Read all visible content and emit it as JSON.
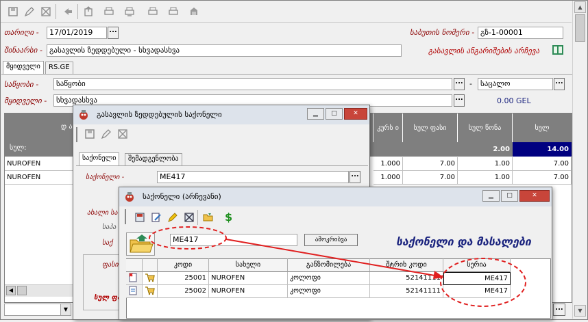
{
  "colors": {
    "label": "#8b0000",
    "accent_blue": "#1a237e",
    "total_row": "#000080",
    "grid_header": "#7f7f7f",
    "annotation": "#e02020"
  },
  "main": {
    "toolbar_icons": [
      "save-icon",
      "edit-icon",
      "delete-icon",
      "back-arrow-icon",
      "export-icon",
      "print-icon",
      "print-preview-icon",
      "copy-icon",
      "paste-icon",
      "archive-icon"
    ],
    "date_label": "თარიღი -",
    "date_value": "17/01/2019",
    "doc_number_label": "საბუთის ნომერი -",
    "doc_number_value": "გზ-1-00001",
    "note_label": "შინაარსი -",
    "note_value": "გასავლის ზედდებული - სხვადასხვა",
    "invoice_link": "გასავლის ანგარიშების არჩევა",
    "tabs": [
      "მყიდველი",
      "RS.GE"
    ],
    "warehouse_label": "საწყობი -",
    "warehouse_value": "საწყობი",
    "price_type_value": "საცალო",
    "buyer_label": "მყიდველი -",
    "buyer_value": "სხვადასხვა",
    "buyer_balance": "0.00 GEL",
    "grid": {
      "headers": {
        "name_partial": "დ ა",
        "rate": "კურს ი",
        "total_price": "სულ ფასი",
        "total_weight": "სულ წონა",
        "total": "სულ"
      },
      "total_row": {
        "label": "სულ:",
        "weight": "2.00",
        "total": "14.00"
      },
      "rows": [
        {
          "name": "NUROFEN",
          "rate": "1.000",
          "total_price": "7.00",
          "total_weight": "1.00",
          "total": "7.00"
        },
        {
          "name": "NUROFEN",
          "rate": "1.000",
          "total_price": "7.00",
          "total_weight": "1.00",
          "total": "7.00"
        }
      ]
    },
    "footer_text": "RS.GE"
  },
  "goods_window": {
    "title": "გასავლის ზედდებულის საქონელი",
    "tabs": [
      "საქონელი",
      "შემადგენლობა"
    ],
    "goods_label": "საქონელი -",
    "goods_value": "ME417",
    "left_labels": [
      "ახალი სა",
      "საპა",
      "საქ",
      "ფასი",
      "სულ ფას"
    ]
  },
  "picker_window": {
    "title": "საქონელი (არჩევანი)",
    "search_value": "ME417",
    "search_button": "ამოკრიბვა",
    "heading": "საქონელი და მასალები",
    "columns": [
      "კოდი",
      "სახელი",
      "განზომილება",
      "შტრიხ კოდი",
      "სერია"
    ],
    "rows": [
      {
        "code": "25001",
        "name": "NUROFEN",
        "unit": "კოლოფი",
        "barcode": "52141111",
        "series": "ME417"
      },
      {
        "code": "25002",
        "name": "NUROFEN",
        "unit": "კოლოფი",
        "barcode": "52141111",
        "series": "ME417"
      }
    ]
  }
}
